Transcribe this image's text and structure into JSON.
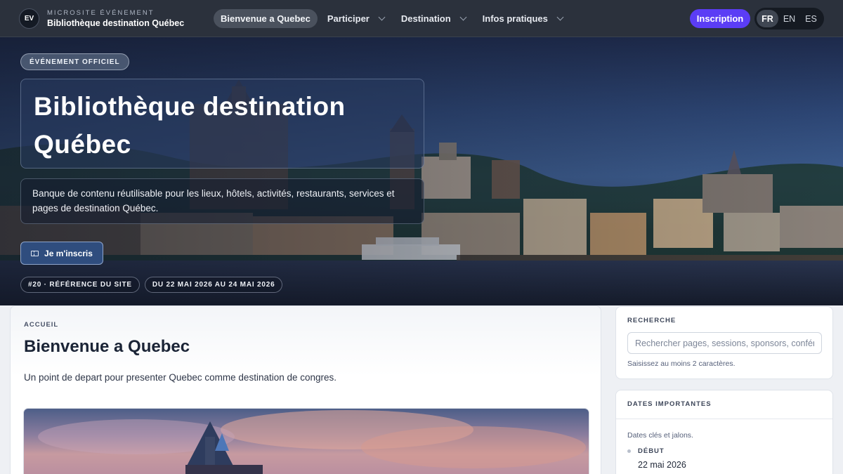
{
  "nav": {
    "logo": "EV",
    "kicker": "MICROSITE ÉVÉNEMENT",
    "site_name": "Bibliothèque destination Québec",
    "menu": [
      {
        "label": "Bienvenue a Quebec",
        "active": true
      },
      {
        "label": "Participer",
        "dropdown": true
      },
      {
        "label": "Destination",
        "dropdown": true
      },
      {
        "label": "Infos pratiques",
        "dropdown": true
      }
    ],
    "cta_label": "Inscription",
    "languages": [
      "FR",
      "EN",
      "ES"
    ],
    "active_language": "FR"
  },
  "hero": {
    "badge": "ÉVÉNEMENT OFFICIEL",
    "title_line1": "Bibliothèque destination",
    "title_line2": "Québec",
    "description": "Banque de contenu réutilisable pour les lieux, hôtels, activités, restaurants, services et pages de destination Québec.",
    "register_label": "Je m'inscris",
    "site_ref": "#20 · RÉFÉRENCE DU SITE",
    "dates": "DU 22 MAI 2026 AU 24 MAI 2026"
  },
  "main": {
    "breadcrumb": "ACCUEIL",
    "title": "Bienvenue a Quebec",
    "lead": "Un point de depart pour presenter Quebec comme destination de congres."
  },
  "search": {
    "label": "RECHERCHE",
    "placeholder": "Rechercher pages, sessions, sponsors, conférenciers",
    "hint": "Saisissez au moins 2 caractères."
  },
  "dates": {
    "heading": "DATES IMPORTANTES",
    "subtitle": "Dates clés et jalons.",
    "items": [
      {
        "label": "DÉBUT",
        "value": "22 mai 2026"
      }
    ]
  }
}
